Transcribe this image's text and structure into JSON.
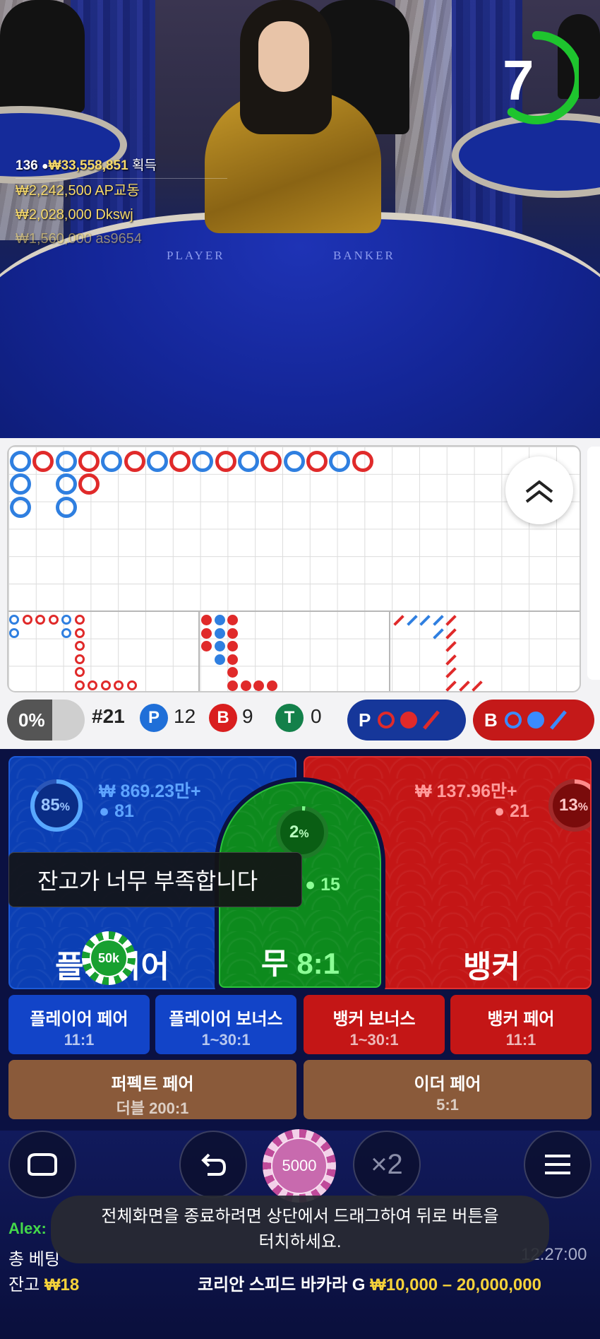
{
  "video": {
    "timer_value": "7",
    "timer_progress": 0.6,
    "table_labels": [
      "PLAYER",
      "BANKER"
    ],
    "winners_total": {
      "count": "136",
      "amount": "₩33,558,851",
      "label": "획득"
    },
    "winners": [
      {
        "amount": "₩2,242,500",
        "name": "AP교동"
      },
      {
        "amount": "₩2,028,000",
        "name": "Dkswj"
      },
      {
        "amount": "₩1,560,000",
        "name": "as9654"
      }
    ]
  },
  "roadmap": {
    "colors": {
      "player": "#2f7fe0",
      "banker": "#e02a2a"
    },
    "big_road": [
      [
        "P",
        "P",
        "P"
      ],
      [
        "B"
      ],
      [
        "P",
        "P",
        "P"
      ],
      [
        "B",
        "B"
      ],
      [
        "P"
      ],
      [
        "B"
      ],
      [
        "P"
      ],
      [
        "B"
      ],
      [
        "P"
      ],
      [
        "B"
      ],
      [
        "P"
      ],
      [
        "B"
      ],
      [
        "P"
      ],
      [
        "B"
      ],
      [
        "P"
      ],
      [
        "B"
      ]
    ]
  },
  "stats": {
    "percent": "0%",
    "round": "#21",
    "player": {
      "letter": "P",
      "count": "12"
    },
    "banker": {
      "letter": "B",
      "count": "9"
    },
    "tie": {
      "letter": "T",
      "count": "0"
    },
    "predict_player": "P",
    "predict_banker": "B"
  },
  "board": {
    "player": {
      "amount": "₩ 869.23만+",
      "players": "81",
      "percent": "85",
      "percent_fraction": 0.85,
      "label": "플레이어"
    },
    "tie": {
      "percent": "2",
      "percent_fraction": 0.02,
      "players": "15",
      "label": "무",
      "odds": "8:1"
    },
    "banker": {
      "amount": "₩ 137.96만+",
      "players": "21",
      "percent": "13",
      "percent_fraction": 0.13,
      "label": "뱅커"
    },
    "percent_sign": "%",
    "side_bets": [
      {
        "title": "플레이어 페어",
        "odds": "11:1"
      },
      {
        "title": "플레이어 보너스",
        "odds": "1~30:1"
      },
      {
        "title": "뱅커 보너스",
        "odds": "1~30:1"
      },
      {
        "title": "뱅커 페어",
        "odds": "11:1"
      }
    ],
    "perfect_pair": {
      "title": "퍼펙트 페어",
      "odds": "더블 200:1"
    },
    "either_pair": {
      "title": "이더 페어",
      "odds": "5:1"
    },
    "toast": "잔고가 너무 부족합니다",
    "placed_chip": "50k"
  },
  "controls": {
    "chip_value": "5000",
    "double_label": "×2",
    "fullscreen_toast": [
      "전체화면을 종료하려면 상단에서 드래그하여 뒤로 버튼을",
      "터치하세요."
    ]
  },
  "footer": {
    "chat_user": "Alex:",
    "total_bet_label": "총 베팅",
    "time": "12:27:00",
    "balance_label": "잔고",
    "balance_value": "₩18",
    "game_name": "코리안 스피드 바카라 G",
    "limits": "₩10,000 – 20,000,000"
  }
}
